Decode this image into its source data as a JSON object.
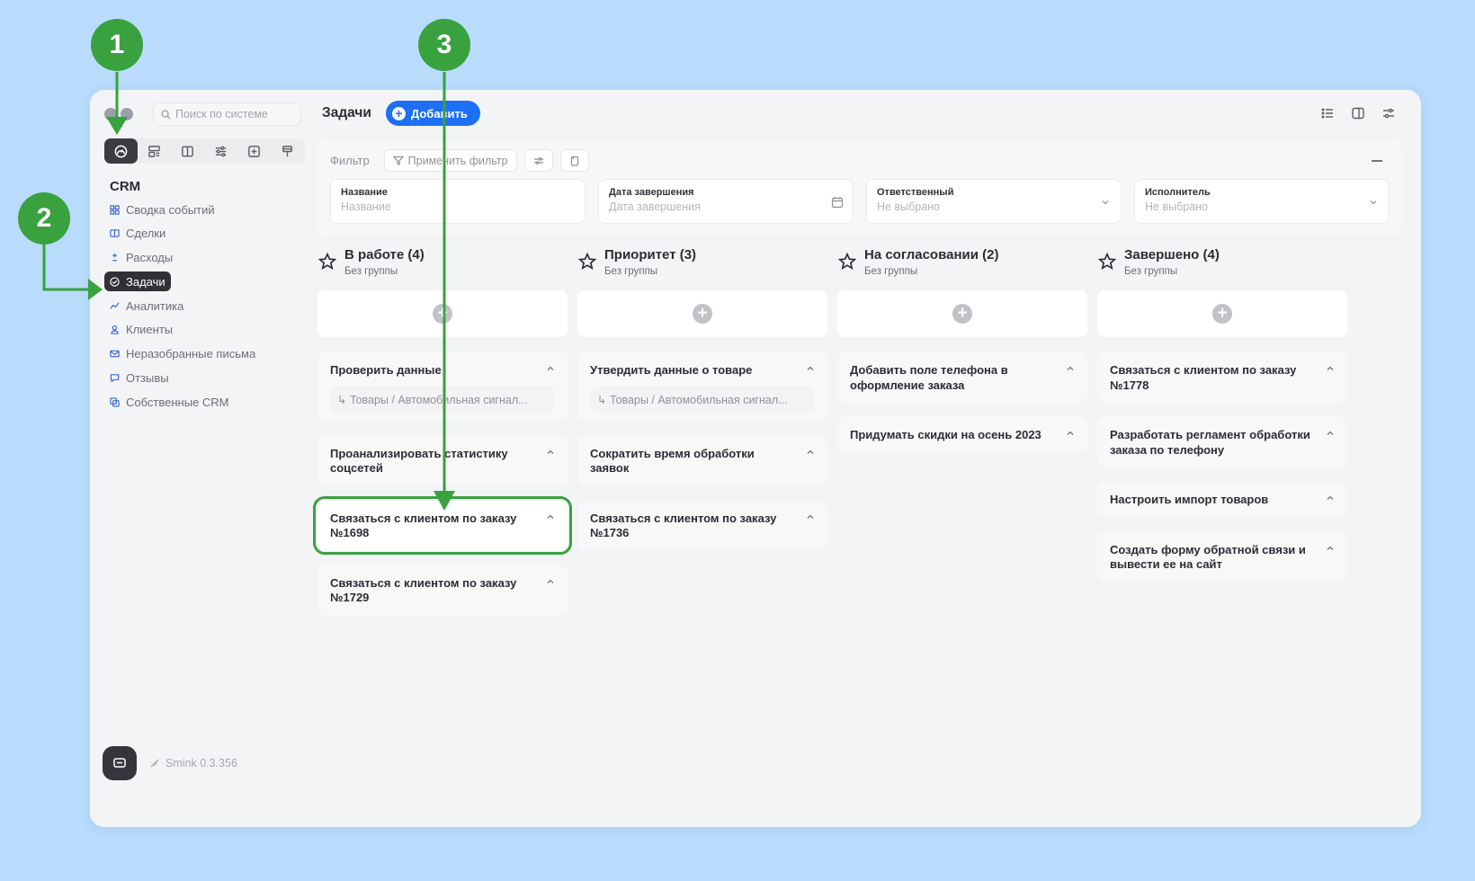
{
  "search": {
    "placeholder": "Поиск по системе"
  },
  "sidebar": {
    "section_title": "CRM",
    "items": [
      {
        "label": "Сводка событий",
        "icon": "grid-icon"
      },
      {
        "label": "Сделки",
        "icon": "columns-icon"
      },
      {
        "label": "Расходы",
        "icon": "plus-minus-icon"
      },
      {
        "label": "Задачи",
        "icon": "check-circle-icon",
        "active": true
      },
      {
        "label": "Аналитика",
        "icon": "chart-line-icon"
      },
      {
        "label": "Клиенты",
        "icon": "user-icon"
      },
      {
        "label": "Неразобранные письма",
        "icon": "mail-icon"
      },
      {
        "label": "Отзывы",
        "icon": "comment-icon"
      },
      {
        "label": "Собственные CRM",
        "icon": "copy-icon"
      }
    ],
    "version": "Smink 0.3.356"
  },
  "header": {
    "title": "Задачи",
    "add_label": "Добавить"
  },
  "filter": {
    "label": "Фильтр",
    "apply_label": "Применить фильтр",
    "fields": [
      {
        "label": "Название",
        "value": "Название"
      },
      {
        "label": "Дата завершения",
        "value": "Дата завершения"
      },
      {
        "label": "Ответственный",
        "value": "Не выбрано"
      },
      {
        "label": "Исполнитель",
        "value": "Не выбрано"
      }
    ]
  },
  "columns": [
    {
      "title": "В работе (4)",
      "subtitle": "Без группы",
      "cards": [
        {
          "title": "Проверить данные",
          "sub": "↳ Товары / Автомобильная сигнал..."
        },
        {
          "title": "Проанализировать статистику соцсетей"
        },
        {
          "title": "Связаться с клиентом по заказу №1698",
          "highlight": true
        },
        {
          "title": "Связаться с клиентом по заказу №1729"
        }
      ]
    },
    {
      "title": "Приоритет (3)",
      "subtitle": "Без группы",
      "cards": [
        {
          "title": "Утвердить данные о товаре",
          "sub": "↳ Товары / Автомобильная сигнал..."
        },
        {
          "title": "Сократить время обработки заявок"
        },
        {
          "title": "Связаться с клиентом по заказу №1736"
        }
      ]
    },
    {
      "title": "На согласовании (2)",
      "subtitle": "Без группы",
      "cards": [
        {
          "title": "Добавить поле телефона в оформление заказа"
        },
        {
          "title": "Придумать скидки на осень 2023"
        }
      ]
    },
    {
      "title": "Завершено (4)",
      "subtitle": "Без группы",
      "cards": [
        {
          "title": "Связаться с клиентом по заказу №1778"
        },
        {
          "title": "Разработать регламент обработки заказа по телефону"
        },
        {
          "title": "Настроить импорт товаров"
        },
        {
          "title": "Создать форму обратной связи и вывести ее на сайт"
        }
      ]
    }
  ],
  "annotations": [
    "1",
    "2",
    "3"
  ],
  "colors": {
    "accent": "#1d6ff5",
    "annotation": "#3aa13f",
    "active_bg": "#2f3136"
  }
}
